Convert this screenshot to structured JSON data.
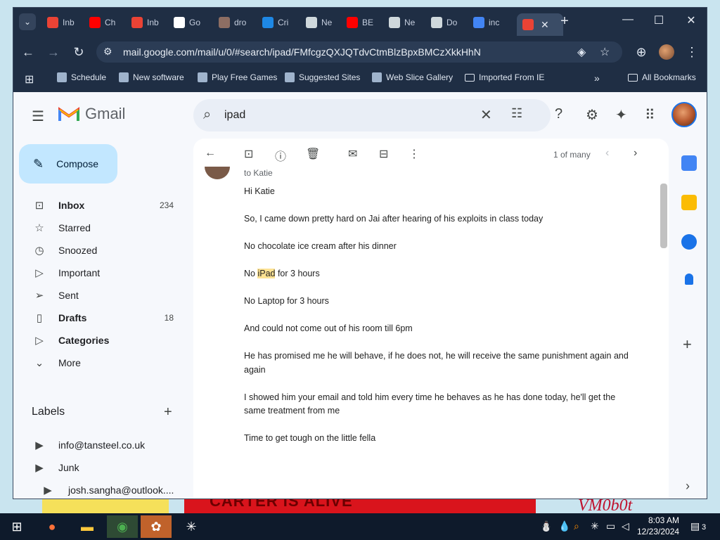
{
  "wallpaper": {
    "banner_text": "CARTER IS ALIVE",
    "signature": "VM0b0t"
  },
  "browser": {
    "tabs": [
      {
        "label": "Inb",
        "icon": "gmail-icon",
        "color": "#ea4335"
      },
      {
        "label": "Ch",
        "icon": "youtube-icon",
        "color": "#ff0000"
      },
      {
        "label": "Inb",
        "icon": "gmail-icon",
        "color": "#ea4335"
      },
      {
        "label": "Go",
        "icon": "google-lens-icon",
        "color": "#ffffff"
      },
      {
        "label": "dro",
        "icon": "folder-icon",
        "color": "#8d6e63"
      },
      {
        "label": "Cri",
        "icon": "edge-icon",
        "color": "#1e88e5"
      },
      {
        "label": "Ne",
        "icon": "globe-icon",
        "color": "#cfd8dc"
      },
      {
        "label": "BE",
        "icon": "youtube-icon",
        "color": "#ff0000"
      },
      {
        "label": "Ne",
        "icon": "globe-icon",
        "color": "#cfd8dc"
      },
      {
        "label": "Do",
        "icon": "download-icon",
        "color": "#cfd8dc"
      },
      {
        "label": "inc",
        "icon": "google-icon",
        "color": "#4285f4"
      }
    ],
    "active_tab": {
      "label": "",
      "icon": "gmail-icon",
      "color": "#ea4335"
    },
    "url": "mail.google.com/mail/u/0/#search/ipad/FMfcgzQXJQTdvCtmBlzBpxBMCzXkkHhN",
    "bookmarks": [
      {
        "label": "Schedule",
        "icon": "schedule-icon"
      },
      {
        "label": "New software",
        "icon": "software-icon"
      },
      {
        "label": "Play Free Games",
        "icon": "games-icon"
      },
      {
        "label": "Suggested Sites",
        "icon": "ie-icon"
      },
      {
        "label": "Web Slice Gallery",
        "icon": "webslice-icon"
      },
      {
        "label": "Imported From IE",
        "icon": "folder-icon"
      }
    ],
    "all_bookmarks": "All Bookmarks"
  },
  "gmail": {
    "brand": "Gmail",
    "search": {
      "query": "ipad"
    },
    "compose": "Compose",
    "nav": [
      {
        "label": "Inbox",
        "count": "234",
        "icon": "inbox-icon",
        "bold": true
      },
      {
        "label": "Starred",
        "count": "",
        "icon": "star-icon",
        "bold": false
      },
      {
        "label": "Snoozed",
        "count": "",
        "icon": "clock-icon",
        "bold": false
      },
      {
        "label": "Important",
        "count": "",
        "icon": "important-icon",
        "bold": false
      },
      {
        "label": "Sent",
        "count": "",
        "icon": "send-icon",
        "bold": false
      },
      {
        "label": "Drafts",
        "count": "18",
        "icon": "draft-icon",
        "bold": true
      },
      {
        "label": "Categories",
        "count": "",
        "icon": "label-icon",
        "bold": true
      },
      {
        "label": "More",
        "count": "",
        "icon": "chevron-down-icon",
        "bold": false
      }
    ],
    "labels_header": "Labels",
    "labels": [
      {
        "label": "info@tansteel.co.uk"
      },
      {
        "label": "Junk"
      },
      {
        "label": "josh.sangha@outlook...."
      }
    ],
    "pager": "1 of many",
    "message": {
      "to": "to Katie",
      "lines": [
        "Hi Katie",
        "So, I came down pretty hard on Jai after hearing of his exploits in class today",
        "No chocolate ice cream after his dinner",
        "No iPad for 3 hours",
        "No Laptop for 3 hours",
        "And could not come out of his room till 6pm",
        "He has promised me he will behave, if he does not, he will receive the same punishment again and",
        "again",
        "I showed him your email and told him every time he behaves as he has done today, he'll get the",
        "same treatment from me",
        "Time to get tough on the little fella"
      ],
      "highlight_word": "iPad",
      "line3_before": "No ",
      "line3_after": " for 3 hours"
    }
  },
  "taskbar": {
    "time": "8:03 AM",
    "date": "12/23/2024",
    "notifications": "3"
  }
}
